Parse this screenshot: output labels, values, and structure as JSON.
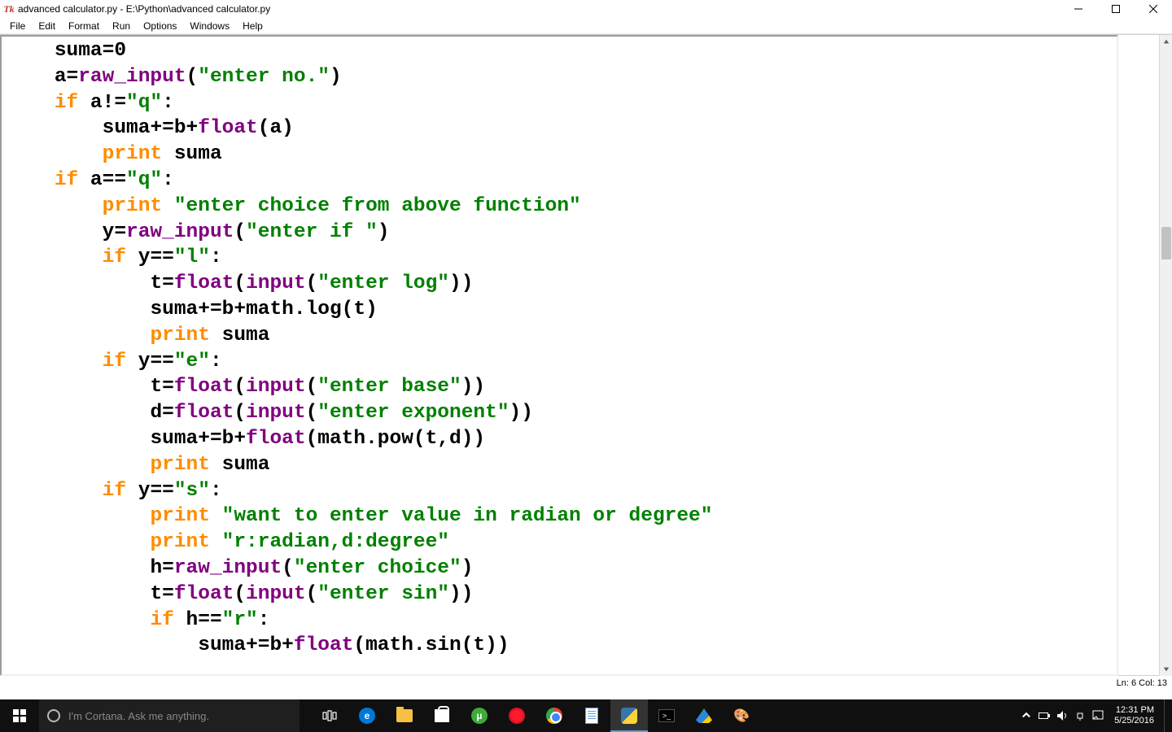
{
  "titlebar": {
    "icon_text": "Tk",
    "title": "advanced calculator.py - E:\\Python\\advanced calculator.py"
  },
  "menubar": {
    "items": [
      "File",
      "Edit",
      "Format",
      "Run",
      "Options",
      "Windows",
      "Help"
    ]
  },
  "status": {
    "text": "Ln: 6 Col: 13"
  },
  "code": {
    "lines": [
      [
        [
          "    ",
          "pad"
        ],
        [
          "suma",
          "name"
        ],
        [
          "=",
          "op"
        ],
        [
          "0",
          "num"
        ]
      ],
      [
        [
          "    ",
          "pad"
        ],
        [
          "a",
          "name"
        ],
        [
          "=",
          "op"
        ],
        [
          "raw_input",
          "bi"
        ],
        [
          "(",
          "op"
        ],
        [
          "\"enter no.\"",
          "str"
        ],
        [
          ")",
          "op"
        ]
      ],
      [
        [
          "    ",
          "pad"
        ],
        [
          "if",
          "kw"
        ],
        [
          " a",
          "name"
        ],
        [
          "!=",
          "op"
        ],
        [
          "\"q\"",
          "str"
        ],
        [
          ":",
          "op"
        ]
      ],
      [
        [
          "        ",
          "pad"
        ],
        [
          "suma",
          "name"
        ],
        [
          "+=",
          "op"
        ],
        [
          "b",
          "name"
        ],
        [
          "+",
          "op"
        ],
        [
          "float",
          "bi"
        ],
        [
          "(",
          "op"
        ],
        [
          "a",
          "name"
        ],
        [
          ")",
          "op"
        ]
      ],
      [
        [
          "        ",
          "pad"
        ],
        [
          "print",
          "kw"
        ],
        [
          " suma",
          "name"
        ]
      ],
      [
        [
          "    ",
          "pad"
        ],
        [
          "if",
          "kw"
        ],
        [
          " a",
          "name"
        ],
        [
          "==",
          "op"
        ],
        [
          "\"q\"",
          "str"
        ],
        [
          ":",
          "op"
        ]
      ],
      [
        [
          "        ",
          "pad"
        ],
        [
          "print",
          "kw"
        ],
        [
          " ",
          "pad"
        ],
        [
          "\"enter choice from above function\"",
          "str"
        ]
      ],
      [
        [
          "        ",
          "pad"
        ],
        [
          "y",
          "name"
        ],
        [
          "=",
          "op"
        ],
        [
          "raw_input",
          "bi"
        ],
        [
          "(",
          "op"
        ],
        [
          "\"enter if \"",
          "str"
        ],
        [
          ")",
          "op"
        ]
      ],
      [
        [
          "        ",
          "pad"
        ],
        [
          "if",
          "kw"
        ],
        [
          " y",
          "name"
        ],
        [
          "==",
          "op"
        ],
        [
          "\"l\"",
          "str"
        ],
        [
          ":",
          "op"
        ]
      ],
      [
        [
          "            ",
          "pad"
        ],
        [
          "t",
          "name"
        ],
        [
          "=",
          "op"
        ],
        [
          "float",
          "bi"
        ],
        [
          "(",
          "op"
        ],
        [
          "input",
          "bi"
        ],
        [
          "(",
          "op"
        ],
        [
          "\"enter log\"",
          "str"
        ],
        [
          "))",
          "op"
        ]
      ],
      [
        [
          "            ",
          "pad"
        ],
        [
          "suma",
          "name"
        ],
        [
          "+=",
          "op"
        ],
        [
          "b",
          "name"
        ],
        [
          "+",
          "op"
        ],
        [
          "math.log(t)",
          "name"
        ]
      ],
      [
        [
          "            ",
          "pad"
        ],
        [
          "print",
          "kw"
        ],
        [
          " suma",
          "name"
        ]
      ],
      [
        [
          "        ",
          "pad"
        ],
        [
          "if",
          "kw"
        ],
        [
          " y",
          "name"
        ],
        [
          "==",
          "op"
        ],
        [
          "\"e\"",
          "str"
        ],
        [
          ":",
          "op"
        ]
      ],
      [
        [
          "            ",
          "pad"
        ],
        [
          "t",
          "name"
        ],
        [
          "=",
          "op"
        ],
        [
          "float",
          "bi"
        ],
        [
          "(",
          "op"
        ],
        [
          "input",
          "bi"
        ],
        [
          "(",
          "op"
        ],
        [
          "\"enter base\"",
          "str"
        ],
        [
          "))",
          "op"
        ]
      ],
      [
        [
          "            ",
          "pad"
        ],
        [
          "d",
          "name"
        ],
        [
          "=",
          "op"
        ],
        [
          "float",
          "bi"
        ],
        [
          "(",
          "op"
        ],
        [
          "input",
          "bi"
        ],
        [
          "(",
          "op"
        ],
        [
          "\"enter exponent\"",
          "str"
        ],
        [
          "))",
          "op"
        ]
      ],
      [
        [
          "            ",
          "pad"
        ],
        [
          "suma",
          "name"
        ],
        [
          "+=",
          "op"
        ],
        [
          "b",
          "name"
        ],
        [
          "+",
          "op"
        ],
        [
          "float",
          "bi"
        ],
        [
          "(",
          "op"
        ],
        [
          "math.pow(t,d)",
          "name"
        ],
        [
          ")",
          "op"
        ]
      ],
      [
        [
          "            ",
          "pad"
        ],
        [
          "print",
          "kw"
        ],
        [
          " suma",
          "name"
        ]
      ],
      [
        [
          "        ",
          "pad"
        ],
        [
          "if",
          "kw"
        ],
        [
          " y",
          "name"
        ],
        [
          "==",
          "op"
        ],
        [
          "\"s\"",
          "str"
        ],
        [
          ":",
          "op"
        ]
      ],
      [
        [
          "            ",
          "pad"
        ],
        [
          "print",
          "kw"
        ],
        [
          " ",
          "pad"
        ],
        [
          "\"want to enter value in radian or degree\"",
          "str"
        ]
      ],
      [
        [
          "            ",
          "pad"
        ],
        [
          "print",
          "kw"
        ],
        [
          " ",
          "pad"
        ],
        [
          "\"r:radian,d:degree\"",
          "str"
        ]
      ],
      [
        [
          "            ",
          "pad"
        ],
        [
          "h",
          "name"
        ],
        [
          "=",
          "op"
        ],
        [
          "raw_input",
          "bi"
        ],
        [
          "(",
          "op"
        ],
        [
          "\"enter choice\"",
          "str"
        ],
        [
          ")",
          "op"
        ]
      ],
      [
        [
          "            ",
          "pad"
        ],
        [
          "t",
          "name"
        ],
        [
          "=",
          "op"
        ],
        [
          "float",
          "bi"
        ],
        [
          "(",
          "op"
        ],
        [
          "input",
          "bi"
        ],
        [
          "(",
          "op"
        ],
        [
          "\"enter sin\"",
          "str"
        ],
        [
          "))",
          "op"
        ]
      ],
      [
        [
          "            ",
          "pad"
        ],
        [
          "if",
          "kw"
        ],
        [
          " h",
          "name"
        ],
        [
          "==",
          "op"
        ],
        [
          "\"r\"",
          "str"
        ],
        [
          ":",
          "op"
        ]
      ],
      [
        [
          "                ",
          "pad"
        ],
        [
          "suma",
          "name"
        ],
        [
          "+=",
          "op"
        ],
        [
          "b",
          "name"
        ],
        [
          "+",
          "op"
        ],
        [
          "float",
          "bi"
        ],
        [
          "(",
          "op"
        ],
        [
          "math.sin(t)",
          "name"
        ],
        [
          ")",
          "op"
        ]
      ]
    ]
  },
  "taskbar": {
    "cortana_placeholder": "I'm Cortana. Ask me anything.",
    "clock_time": "12:31 PM",
    "clock_date": "5/25/2016",
    "icons": [
      {
        "name": "taskview-icon"
      },
      {
        "name": "edge-icon"
      },
      {
        "name": "file-explorer-icon"
      },
      {
        "name": "store-icon"
      },
      {
        "name": "utorrent-icon"
      },
      {
        "name": "opera-icon"
      },
      {
        "name": "chrome-icon"
      },
      {
        "name": "notepadpp-icon"
      },
      {
        "name": "python-idle-icon"
      },
      {
        "name": "cmd-icon"
      },
      {
        "name": "google-drive-icon"
      },
      {
        "name": "paint-icon"
      }
    ]
  }
}
